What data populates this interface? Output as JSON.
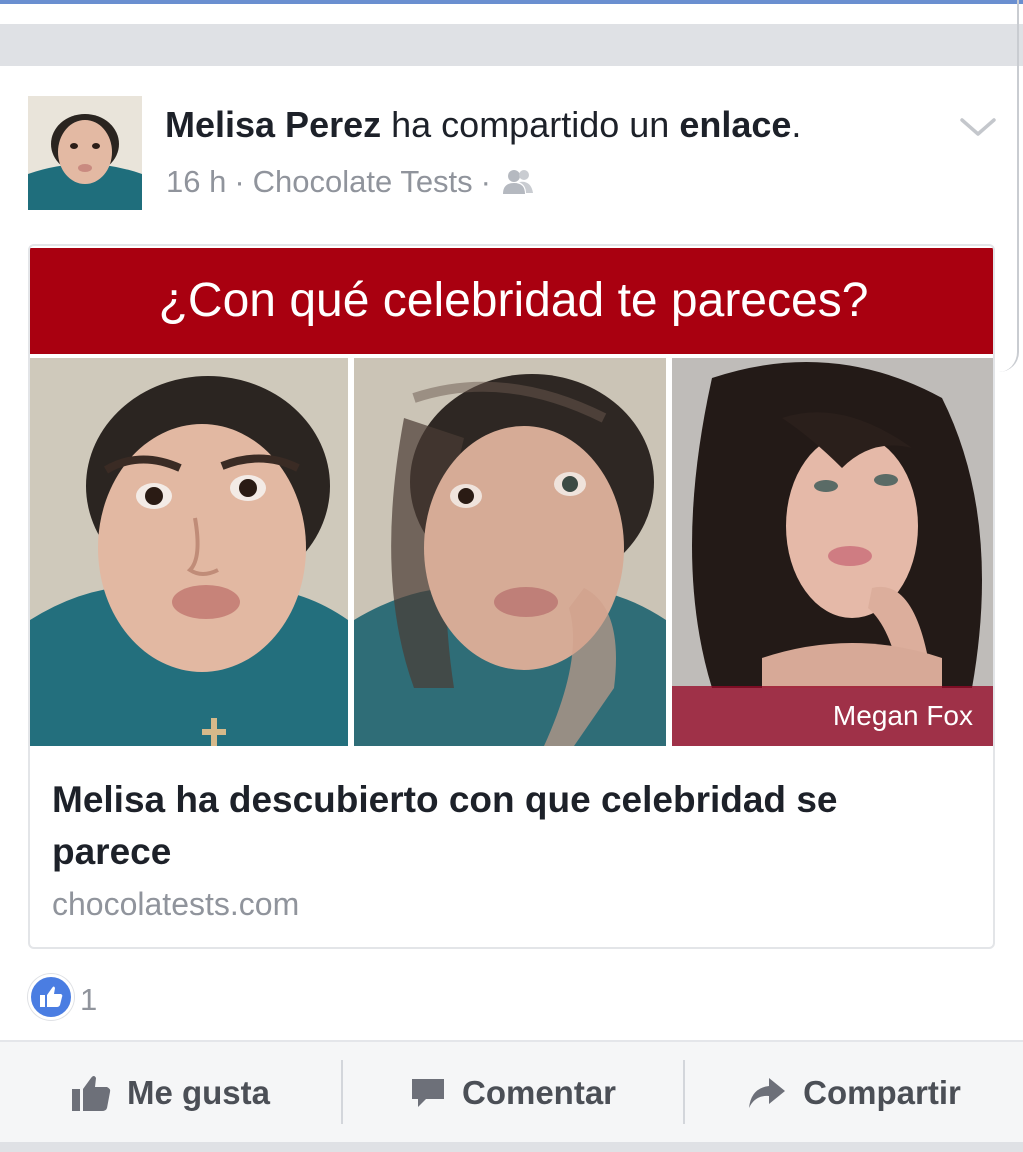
{
  "post": {
    "author": "Melisa Perez",
    "action_text": " ha compartido un ",
    "object_text": "enlace",
    "period": ".",
    "time": "16 h",
    "separator": "·",
    "app": "Chocolate Tests",
    "audience_icon": "friends-icon",
    "menu_icon": "chevron-down-icon"
  },
  "link_card": {
    "banner_text": "¿Con qué celebridad te pareces?",
    "celebrity_name": "Megan Fox",
    "title": "Melisa ha descubierto con que celebridad se parece",
    "domain": "chocolatests.com"
  },
  "reactions": {
    "icon": "thumbs-up-icon",
    "count": "1"
  },
  "actions": {
    "like": "Me gusta",
    "comment": "Comentar",
    "share": "Compartir"
  },
  "colors": {
    "banner": "#a90010",
    "like_badge": "#4a7de2",
    "muted_text": "#90949c"
  }
}
